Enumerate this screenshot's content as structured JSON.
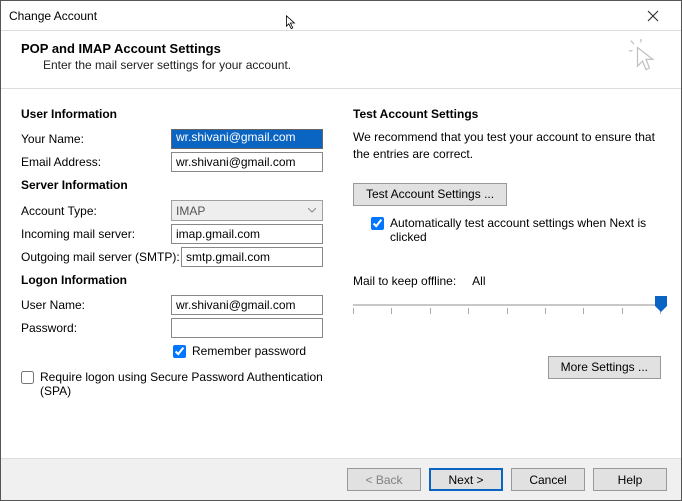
{
  "window": {
    "title": "Change Account"
  },
  "header": {
    "title": "POP and IMAP Account Settings",
    "subtitle": "Enter the mail server settings for your account."
  },
  "left": {
    "user_info_title": "User Information",
    "your_name_label": "Your Name:",
    "your_name_value": "wr.shivani@gmail.com",
    "email_label": "Email Address:",
    "email_value": "wr.shivani@gmail.com",
    "server_info_title": "Server Information",
    "account_type_label": "Account Type:",
    "account_type_value": "IMAP",
    "incoming_label": "Incoming mail server:",
    "incoming_value": "imap.gmail.com",
    "outgoing_label": "Outgoing mail server (SMTP):",
    "outgoing_value": "smtp.gmail.com",
    "logon_info_title": "Logon Information",
    "username_label": "User Name:",
    "username_value": "wr.shivani@gmail.com",
    "password_label": "Password:",
    "password_value": "",
    "remember_pw_label": "Remember password",
    "spa_label": "Require logon using Secure Password Authentication (SPA)"
  },
  "right": {
    "test_title": "Test Account Settings",
    "test_desc": "We recommend that you test your account to ensure that the entries are correct.",
    "test_btn": "Test Account Settings ...",
    "auto_test_label": "Automatically test account settings when Next is clicked",
    "mail_keep_label": "Mail to keep offline:",
    "mail_keep_value": "All",
    "more_settings_btn": "More Settings ..."
  },
  "footer": {
    "back": "< Back",
    "next": "Next >",
    "cancel": "Cancel",
    "help": "Help"
  }
}
